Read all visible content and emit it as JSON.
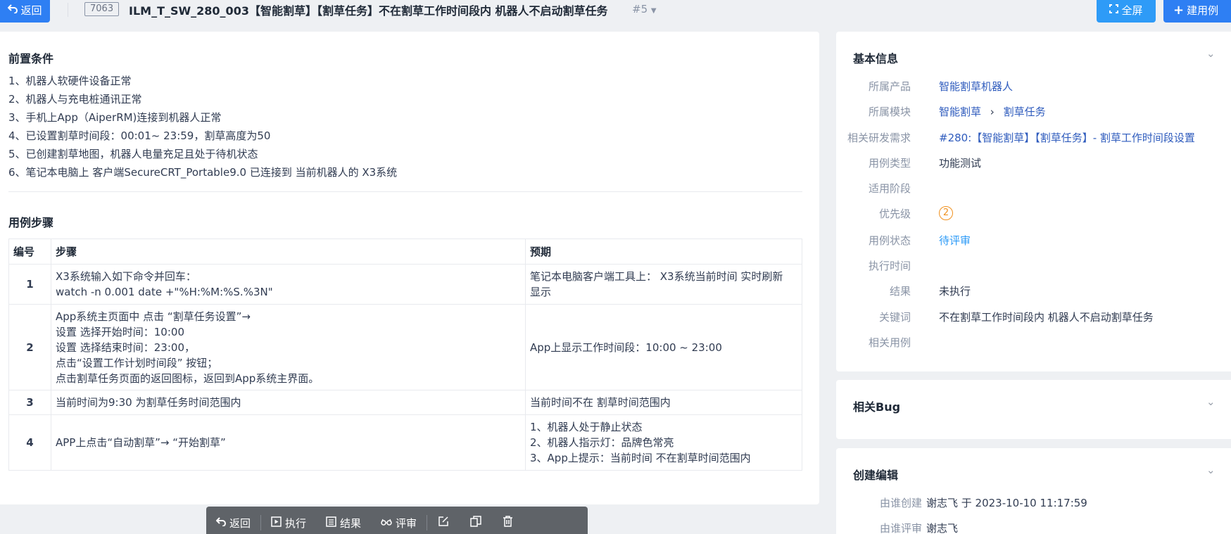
{
  "toolbar": {
    "back_label": "返回",
    "case_id": "7063",
    "case_title": "ILM_T_SW_280_003【智能割草】【割草任务】不在割草工作时间段内 机器人不启动割草任务",
    "version": "#5",
    "fullscreen_label": "全屏",
    "new_case_label": "建用例"
  },
  "precondition": {
    "title": "前置条件",
    "items": [
      "1、机器人软硬件设备正常",
      "2、机器人与充电桩通讯正常",
      "3、手机上App（AiperRM)连接到机器人正常",
      "4、已设置割草时间段：00:01~ 23:59，割草高度为50",
      "5、已创建割草地图，机器人电量充足且处于待机状态",
      "6、笔记本电脑上 客户端SecureCRT_Portable9.0 已连接到 当前机器人的 X3系统"
    ]
  },
  "steps": {
    "title": "用例步骤",
    "headers": [
      "编号",
      "步骤",
      "预期"
    ],
    "rows": [
      {
        "num": "1",
        "step": [
          "X3系统输入如下命令并回车：",
          "watch -n 0.001 date +\"%H:%M:%S.%3N\""
        ],
        "expect": [
          "笔记本电脑客户端工具上： X3系统当前时间 实时刷新",
          "显示"
        ]
      },
      {
        "num": "2",
        "step": [
          "App系统主页面中 点击 “割草任务设置”→",
          "设置 选择开始时间：10:00",
          "设置 选择结束时间：23:00，",
          "点击“设置工作计划时间段” 按钮；",
          "点击割草任务页面的返回图标，返回到App系统主界面。"
        ],
        "expect": [
          "App上显示工作时间段：10:00 ~ 23:00"
        ]
      },
      {
        "num": "3",
        "step": [
          "当前时间为9:30 为割草任务时间范围内"
        ],
        "expect": [
          "当前时间不在 割草时间范围内"
        ]
      },
      {
        "num": "4",
        "step": [
          "APP上点击“自动割草”→ “开始割草”"
        ],
        "expect": [
          "1、机器人处于静止状态",
          "2、机器人指示灯：品牌色常亮",
          "3、App上提示：当前时间 不在割草时间范围内"
        ]
      }
    ]
  },
  "bottom_bar": {
    "back": "返回",
    "execute": "执行",
    "result": "结果",
    "review": "评审"
  },
  "basic_info": {
    "title": "基本信息",
    "product_label": "所属产品",
    "product_value": "智能割草机器人",
    "module_label": "所属模块",
    "module_value_1": "智能割草",
    "module_value_2": "割草任务",
    "story_label": "相关研发需求",
    "story_value": "#280:【智能割草】【割草任务】- 割草工作时间段设置",
    "type_label": "用例类型",
    "type_value": "功能测试",
    "stage_label": "适用阶段",
    "priority_label": "优先级",
    "priority_value": "2",
    "status_label": "用例状态",
    "status_value": "待评审",
    "exec_time_label": "执行时间",
    "result_label": "结果",
    "result_value": "未执行",
    "keywords_label": "关键词",
    "keywords_value": "不在割草工作时间段内 机器人不启动割草任务",
    "related_cases_label": "相关用例"
  },
  "related_bug": {
    "title": "相关Bug"
  },
  "create_edit": {
    "title": "创建编辑",
    "created_by_label": "由谁创建",
    "created_by_value": "谢志飞 于 2023-10-10 11:17:59",
    "reviewed_by_label": "由谁评审",
    "reviewed_by_value": "谢志飞"
  },
  "colors": {
    "primary": "#2e7ff3",
    "secondary": "#2e9bf7",
    "priority": "#f0911f",
    "toolbar_bg": "#5f6368"
  }
}
